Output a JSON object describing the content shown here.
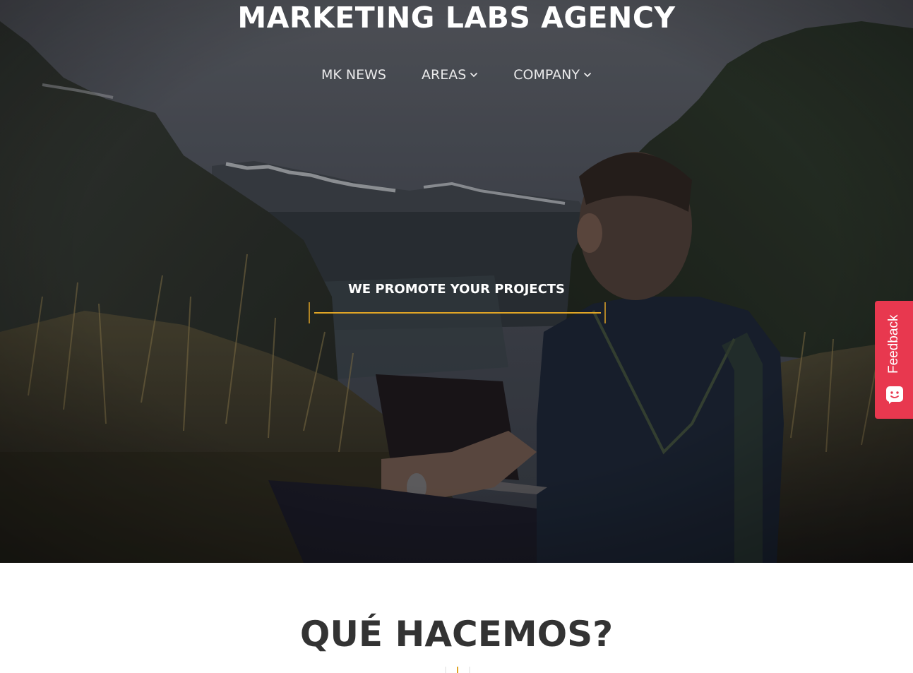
{
  "header": {
    "site_title": "MARKETING LABS AGENCY"
  },
  "nav": {
    "items": [
      {
        "label": "MK NEWS",
        "has_dropdown": false,
        "icon": ""
      },
      {
        "label": "AREAS",
        "has_dropdown": true,
        "icon": "chevron-down-icon"
      },
      {
        "label": "COMPANY",
        "has_dropdown": true,
        "icon": "chevron-down-icon"
      }
    ]
  },
  "hero": {
    "tagline": "WE PROMOTE YOUR PROJECTS",
    "accent_color": "#e0a526"
  },
  "feedback": {
    "label": "Feedback",
    "icon": "smiley-chat-icon",
    "color": "#e8384f"
  },
  "what_we_do": {
    "heading": "QUÉ HACEMOS?"
  },
  "colors": {
    "heading_text": "#333333",
    "nav_text": "#e9e9ea",
    "accent": "#e0a526"
  }
}
